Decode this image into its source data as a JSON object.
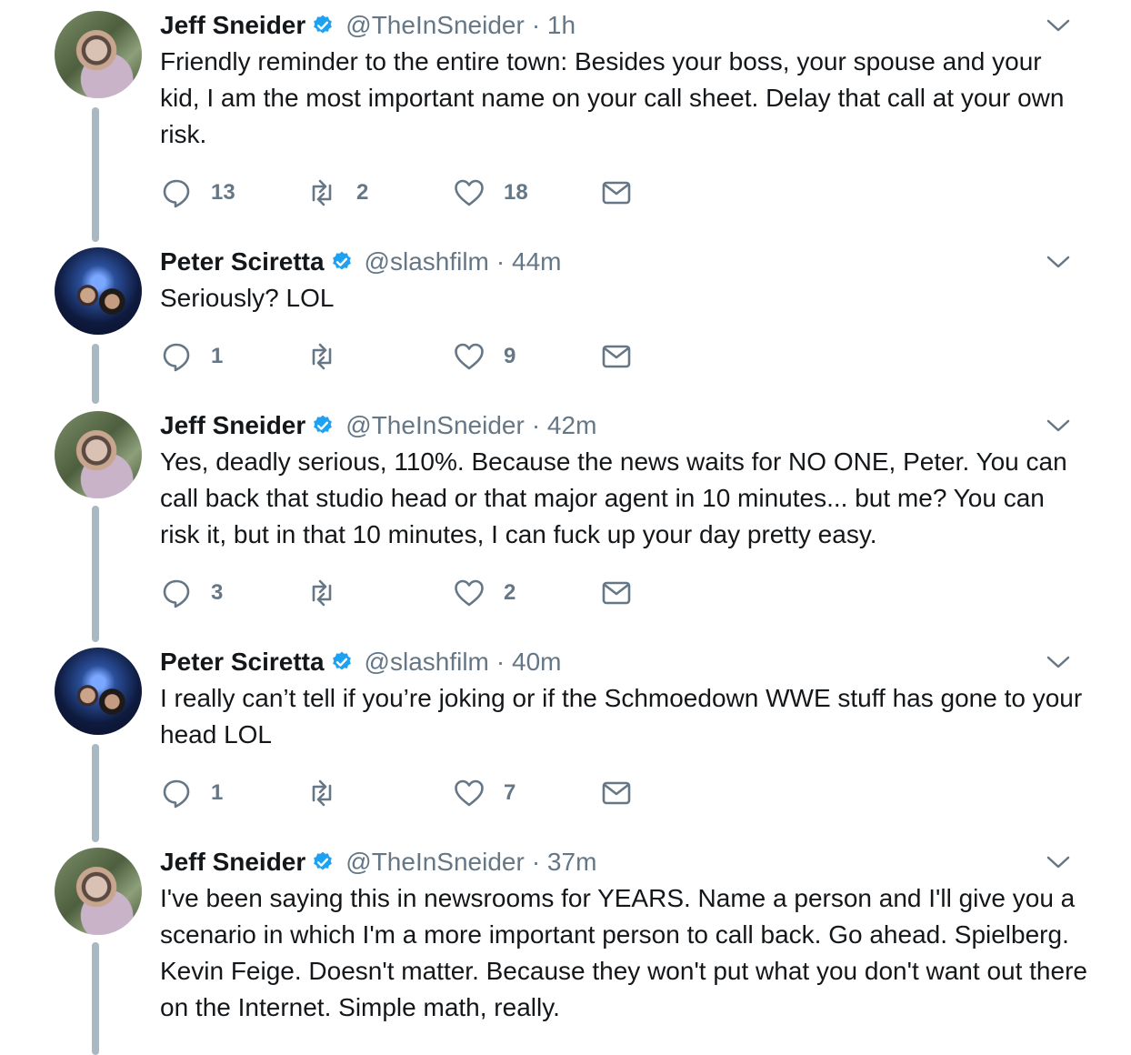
{
  "colors": {
    "text": "#14171a",
    "secondary": "#657786",
    "verified": "#1da1f2",
    "thread_line": "#aab8c2"
  },
  "tweets": [
    {
      "name": "Jeff Sneider",
      "handle": "@TheInSneider",
      "time": "· 1h",
      "text": "Friendly reminder to the entire town: Besides your boss, your spouse and your kid, I am the most important name on your call sheet. Delay that call at your own risk.",
      "replies": "13",
      "retweets": "2",
      "likes": "18",
      "avatar": "jeff-avatar"
    },
    {
      "name": "Peter Sciretta",
      "handle": "@slashfilm",
      "time": "· 44m",
      "text": "Seriously? LOL",
      "replies": "1",
      "retweets": "",
      "likes": "9",
      "avatar": "peter-avatar"
    },
    {
      "name": "Jeff Sneider",
      "handle": "@TheInSneider",
      "time": "· 42m",
      "text": "Yes, deadly serious, 110%. Because the news waits for NO ONE, Peter. You can call back that studio head or that major agent in 10 minutes... but me? You can risk it, but in that 10 minutes, I can fuck up your day pretty easy.",
      "replies": "3",
      "retweets": "",
      "likes": "2",
      "avatar": "jeff-avatar"
    },
    {
      "name": "Peter Sciretta",
      "handle": "@slashfilm",
      "time": "· 40m",
      "text": "I really can’t tell if you’re joking or if the Schmoedown WWE stuff has gone to your head LOL",
      "replies": "1",
      "retweets": "",
      "likes": "7",
      "avatar": "peter-avatar"
    },
    {
      "name": "Jeff Sneider",
      "handle": "@TheInSneider",
      "time": "· 37m",
      "text": "I've been saying this in newsrooms for YEARS. Name a person and I'll give you a scenario in which I'm a more important person to call back. Go ahead. Spielberg. Kevin Feige. Doesn't matter. Because they won't put what you don't want out there on the Internet. Simple math, really.",
      "replies": "",
      "retweets": "",
      "likes": "",
      "avatar": "jeff-avatar"
    }
  ]
}
